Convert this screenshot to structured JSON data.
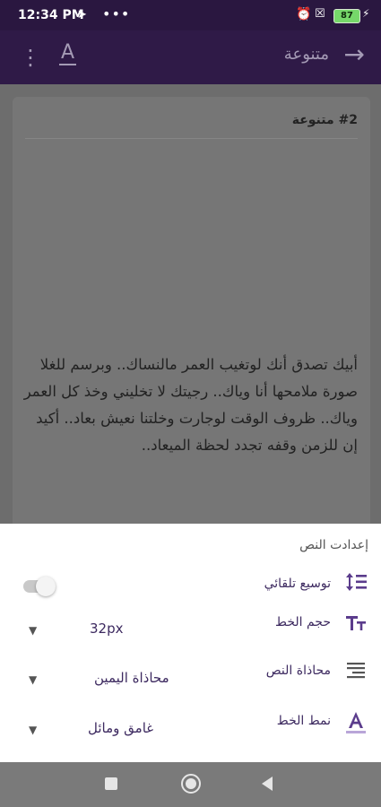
{
  "status_bar": {
    "time": "12:34 PM",
    "telegram_icon": "➤",
    "more_icon": "•••",
    "alarm_icon": "⏰",
    "x_icon": "☒",
    "battery": "87",
    "charging_icon": "⚡"
  },
  "app_bar": {
    "title": "متنوعة",
    "back_icon": "→",
    "menu_icon": "⋮",
    "font_icon": "A"
  },
  "card": {
    "title": "#2  متنوعة",
    "text": "أبيك تصدق أنك لوتغيب العمر مالنساك.. وبرسم للغلا صورة ملامحها أنا وياك.. رجيتك لا تخليني وخذ كل العمر وياك.. ظروف الوقت لوجارت وخلتنا نعيش بعاد.. أكيد إن للزمن وقفه تجدد لحظة الميعاد.."
  },
  "sheet": {
    "title": "إعدادت النص",
    "auto_expand": {
      "label": "توسيع تلقائي",
      "icon": "↕≡",
      "enabled": false
    },
    "font_size": {
      "label": "حجم الخط",
      "icon": "Tт",
      "value": "32px"
    },
    "alignment": {
      "label": "محاذاة النص",
      "icon": "≡",
      "value": "محاذاة اليمين"
    },
    "font_style": {
      "label": "نمط الخط",
      "icon": "A",
      "value": "غامق ومائل"
    },
    "dropdown_icon": "▼"
  },
  "colors": {
    "accent": "#5b3c8c",
    "app_bar": "#2f1a47",
    "battery": "#76d86a"
  }
}
